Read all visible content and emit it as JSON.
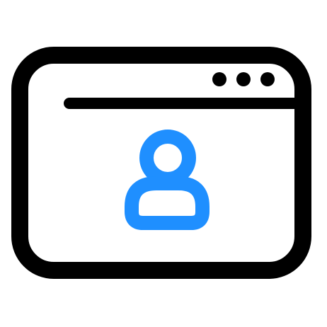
{
  "icon": {
    "name": "browser-window-user-icon",
    "colors": {
      "frame": "#000000",
      "user": "#1f8fff",
      "background": "#ffffff"
    },
    "parts": {
      "window": "browser-window-icon",
      "dots": "window-dots-icon",
      "address_bar": "address-bar-line",
      "user": "user-icon"
    }
  }
}
